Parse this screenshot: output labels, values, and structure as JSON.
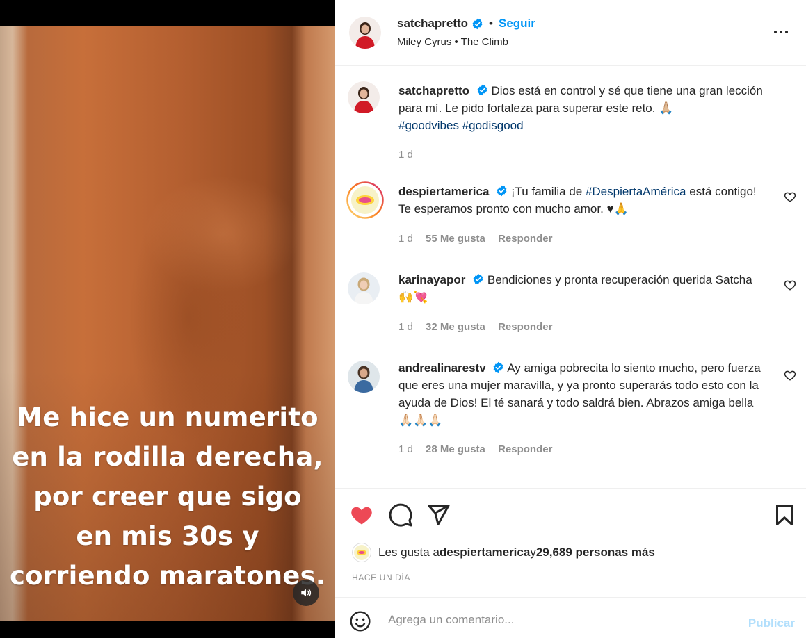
{
  "media": {
    "caption_lines": [
      "Me hice un numerito",
      "en la rodilla derecha,",
      "por creer que sigo",
      "en mis 30s y",
      "corriendo maratones."
    ]
  },
  "header": {
    "username": "satchapretto",
    "separator": "•",
    "follow_label": "Seguir",
    "music": "Miley Cyrus • The Climb"
  },
  "caption": {
    "username": "satchapretto",
    "text": "Dios está en control y sé que tiene una gran lección para mí. Le pido fortaleza para superar este reto. 🙏🏼",
    "hashtags": "#goodvibes #godisgood",
    "time": "1 d"
  },
  "comments": [
    {
      "username": "despiertamerica",
      "pre": "¡Tu familia de ",
      "tag": "#DespiertaAmérica",
      "post": " está contigo! Te esperamos pronto con mucho amor. ♥🙏",
      "time": "1 d",
      "likes": "55 Me gusta",
      "reply": "Responder"
    },
    {
      "username": "karinayapor",
      "text": "Bendiciones y pronta recuperación querida Satcha 🙌💘",
      "time": "1 d",
      "likes": "32 Me gusta",
      "reply": "Responder"
    },
    {
      "username": "andrealinarestv",
      "text": "Ay amiga pobrecita lo siento mucho, pero fuerza que eres una mujer maravilla, y ya pronto superarás todo esto con la ayuda de Dios! El té sanará y todo saldrá bien. Abrazos amiga bella 🙏🏻🙏🏻🙏🏻",
      "time": "1 d",
      "likes": "28 Me gusta",
      "reply": "Responder"
    }
  ],
  "likes": {
    "prefix": "Les gusta a ",
    "user": "despiertamerica",
    "middle": " y ",
    "count": "29,689 personas más"
  },
  "timestamp": "HACE UN DÍA",
  "add_comment": {
    "placeholder": "Agrega un comentario...",
    "publish_label": "Publicar"
  },
  "colors": {
    "accent": "#0095f6",
    "liked": "#ed4956",
    "muted": "#8e8e8e"
  },
  "icons": [
    "sound-icon",
    "verified-icon",
    "more-icon",
    "heart-icon",
    "comment-icon",
    "share-icon",
    "bookmark-icon",
    "emoji-icon"
  ]
}
